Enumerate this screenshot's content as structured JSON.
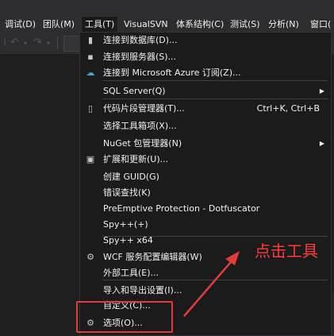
{
  "menubar": {
    "items": [
      "调试(D)",
      "团队(M)",
      "工具(T)",
      "VisualSVN",
      "体系结构(C)",
      "测试(S)",
      "分析(N)",
      "窗口("
    ]
  },
  "tools_menu": {
    "items": [
      {
        "label": "连接到数据库(D)...",
        "icon": "database-connect-icon"
      },
      {
        "label": "连接到服务器(S)...",
        "icon": "server-connect-icon"
      },
      {
        "label": "连接到 Microsoft Azure 订阅(Z)...",
        "icon": "azure-cloud-icon"
      },
      {
        "label": "SQL Server(Q)",
        "submenu": true
      },
      {
        "label": "代码片段管理器(T)...",
        "shortcut": "Ctrl+K, Ctrl+B",
        "icon": "snippet-icon"
      },
      {
        "label": "选择工具箱项(X)..."
      },
      {
        "label": "NuGet 包管理器(N)",
        "submenu": true
      },
      {
        "label": "扩展和更新(U)...",
        "icon": "extensions-icon"
      },
      {
        "label": "创建 GUID(G)"
      },
      {
        "label": "错误查找(K)"
      },
      {
        "label": "PreEmptive Protection - Dotfuscator"
      },
      {
        "label": "Spy++(+)"
      },
      {
        "label": "Spy++ x64"
      },
      {
        "label": "WCF 服务配置编辑器(W)",
        "icon": "wcf-gear-icon"
      },
      {
        "label": "外部工具(E)..."
      },
      {
        "label": "导入和导出设置(I)..."
      },
      {
        "label": "自定义(C)..."
      },
      {
        "label": "选项(O)...",
        "icon": "gear-icon"
      }
    ]
  },
  "annotation": {
    "text": "点击工具",
    "color": "#e23b3b"
  },
  "colors": {
    "menu_bg": "#1b1b1c",
    "menubar_bg": "#2d2d30",
    "text": "#f1f1f1",
    "azure_blue": "#3ea7e4"
  }
}
